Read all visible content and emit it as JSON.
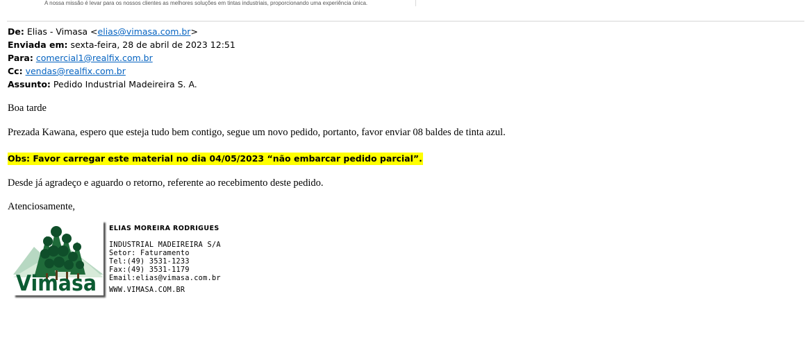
{
  "banner": {
    "mission": "A nossa missão é levar para os nossos clientes as melhores soluções em tintas industriais, proporcionando uma experiência única."
  },
  "email": {
    "from_label": "De:",
    "from_name": "Elias - Vimasa <",
    "from_address": "elias@vimasa.com.br",
    "from_close": ">",
    "sent_label": "Enviada em:",
    "sent_value": "sexta-feira, 28 de abril de 2023 12:51",
    "to_label": "Para:",
    "to_address": "comercial1@realfix.com.br",
    "cc_label": "Cc:",
    "cc_address": "vendas@realfix.com.br",
    "subject_label": "Assunto:",
    "subject_value": "Pedido Industrial Madeireira S. A."
  },
  "message": {
    "greeting": "Boa tarde",
    "paragraph1": "Prezada Kawana, espero que esteja tudo bem contigo, segue um novo pedido, portanto, favor enviar 08 baldes de tinta azul.",
    "obs": "Obs: Favor carregar este material no dia 04/05/2023 “não embarcar pedido parcial”.",
    "paragraph2": "Desde já agradeço e aguardo o retorno, referente ao recebimento deste pedido.",
    "closing": "Atenciosamente,"
  },
  "signature": {
    "logo_text": "Vimasa",
    "name": "ELIAS MOREIRA RODRIGUES",
    "company": "INDUSTRIAL MADEIREIRA S/A",
    "sector": "Setor: Faturamento",
    "tel": "Tel:(49) 3531-1233",
    "fax": "Fax:(49) 3531-1179",
    "email": "Email:elias@vimasa.com.br",
    "website": "WWW.VIMASA.COM.BR"
  },
  "colors": {
    "link": "#0563c1",
    "highlight": "#ffff00",
    "logo_green": "#0b5b32"
  }
}
